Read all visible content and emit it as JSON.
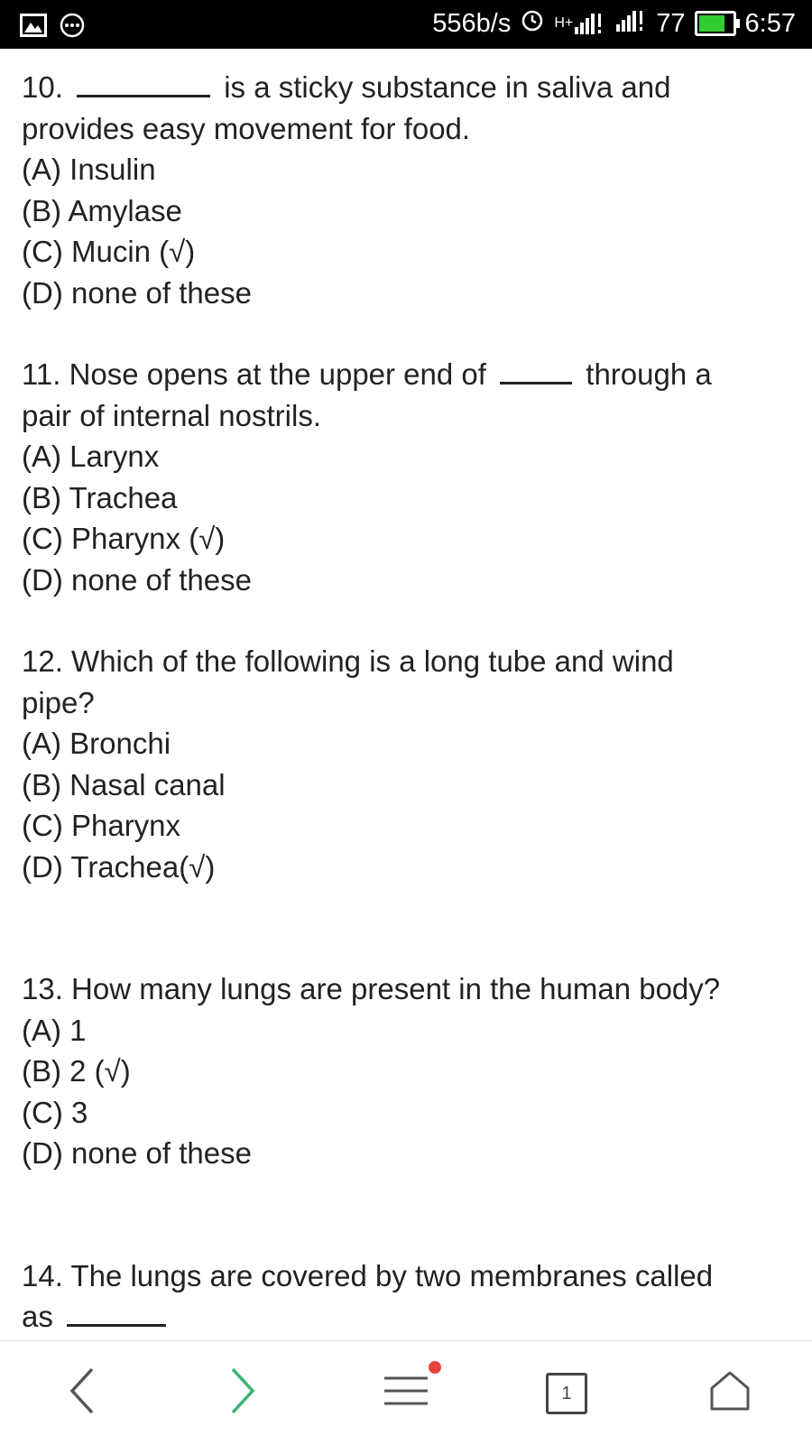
{
  "status_bar": {
    "speed": "556b/s",
    "network": "H+",
    "battery_level": "77",
    "time": "6:57",
    "battery_color": "#33cc33"
  },
  "questions": [
    {
      "number": "10.",
      "text_after_blank": "is a sticky substance in saliva and",
      "text_line2": "provides easy movement for food.",
      "options": [
        "(A) Insulin",
        "(B) Amylase",
        "(C) Mucin (√)",
        "(D) none of these"
      ]
    },
    {
      "text_before_blank": "11. Nose opens at the upper end of",
      "text_after_blank": "through a",
      "text_line2": "pair of internal nostrils.",
      "options": [
        "(A) Larynx",
        "(B) Trachea",
        "(C) Pharynx (√)",
        "(D) none of these"
      ]
    },
    {
      "text": "12. Which of the following is a long tube and wind",
      "text_line2": "pipe?",
      "options": [
        "(A) Bronchi",
        "(B) Nasal canal",
        "(C) Pharynx",
        "(D) Trachea(√)"
      ]
    },
    {
      "text": "13. How many lungs are present in the human body?",
      "options": [
        "(A) 1",
        "(B) 2 (√)",
        "(C) 3",
        "(D) none of these"
      ]
    },
    {
      "text": "14. The lungs are covered by two membranes called",
      "text_line2": "as"
    }
  ],
  "bottom_nav": {
    "tab_count": "1",
    "back_icon": "chevron-left-icon",
    "forward_icon": "chevron-right-icon",
    "menu_icon": "menu-icon",
    "home_icon": "home-icon",
    "forward_color": "#3cb371",
    "notification_dot_color": "#e8433a"
  }
}
